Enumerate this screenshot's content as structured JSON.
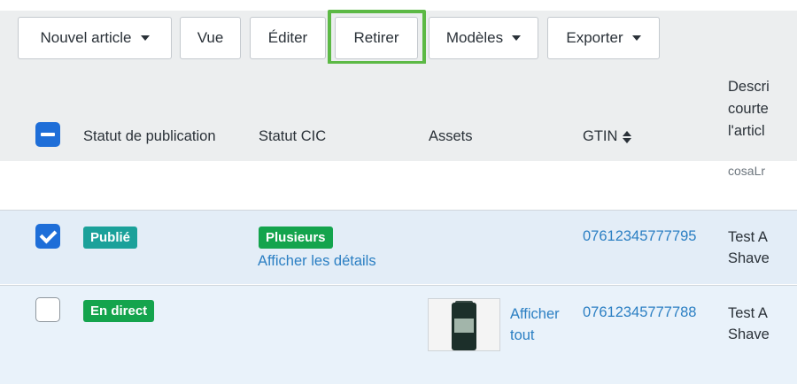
{
  "toolbar": {
    "buttons": [
      {
        "label": "Nouvel article",
        "has_dropdown": true
      },
      {
        "label": "Vue",
        "has_dropdown": false
      },
      {
        "label": "Éditer",
        "has_dropdown": false
      },
      {
        "label": "Retirer",
        "has_dropdown": false,
        "highlighted": true
      },
      {
        "label": "Modèles",
        "has_dropdown": true
      },
      {
        "label": "Exporter",
        "has_dropdown": true
      }
    ]
  },
  "table": {
    "select_all_state": "indeterminate",
    "columns": {
      "publication_status": "Statut de publication",
      "cic_status": "Statut CIC",
      "assets": "Assets",
      "gtin": "GTIN",
      "description_line1": "Descri",
      "description_line2": "courte",
      "description_line3": "l'articl"
    },
    "header_overflow_text": "cosaLr",
    "rows": [
      {
        "selected": true,
        "publication_status": "Publié",
        "cic_status": "Plusieurs",
        "cic_details_link": "Afficher les détails",
        "assets_link_line1": "",
        "assets_link_line2": "",
        "gtin": "07612345777795",
        "description_line1": "Test A",
        "description_line2": "Shave"
      },
      {
        "selected": false,
        "publication_status": "En direct",
        "cic_status": "",
        "cic_details_link": "",
        "thumbnail_brand": "lavera",
        "assets_link_line1": "Afficher",
        "assets_link_line2": "tout",
        "gtin": "07612345777788",
        "description_line1": "Test A",
        "description_line2": "Shave"
      }
    ]
  },
  "colors": {
    "accent_blue": "#1e6ed8",
    "link_blue": "#2b7fc3",
    "badge_teal": "#1ba19a",
    "badge_green": "#14a44d",
    "highlight_green": "#5cb945"
  }
}
